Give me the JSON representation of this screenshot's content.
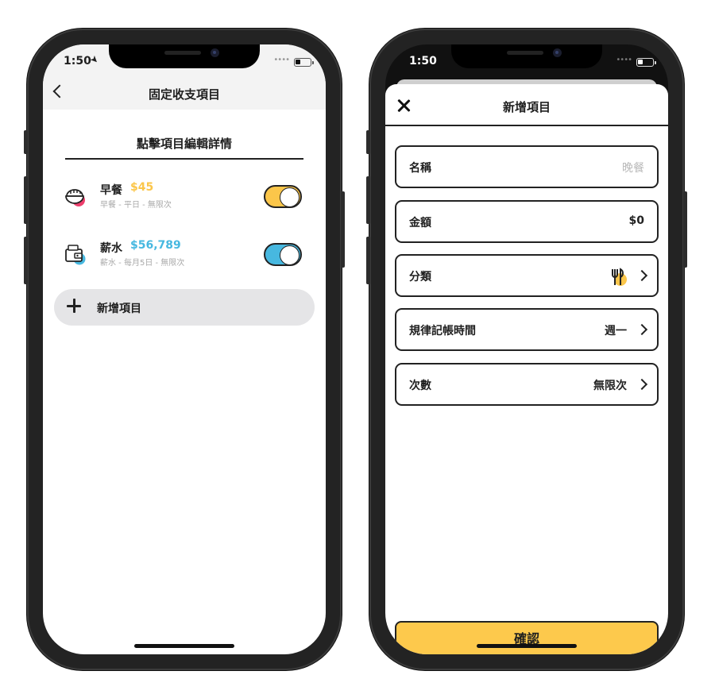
{
  "left_screen": {
    "status": {
      "time": "1:50"
    },
    "header": {
      "title": "固定收支項目"
    },
    "section_title": "點擊項目編輯詳情",
    "items": [
      {
        "name": "早餐",
        "amount": "$45",
        "meta": "早餐 - 平日 - 無限次",
        "icon": "rice-bowl-icon",
        "accent": "#fbc64a",
        "enabled": true
      },
      {
        "name": "薪水",
        "amount": "$56,789",
        "meta": "薪水 - 每月5日 - 無限次",
        "icon": "wallet-icon",
        "accent": "#47b8e0",
        "enabled": true
      }
    ],
    "add_label": "新增項目"
  },
  "right_screen": {
    "status": {
      "time": "1:50"
    },
    "sheet_title": "新增項目",
    "fields": {
      "name": {
        "label": "名稱",
        "placeholder": "晚餐"
      },
      "amount": {
        "label": "金額",
        "value": "$0"
      },
      "category": {
        "label": "分類",
        "icon": "fork-knife-icon"
      },
      "schedule": {
        "label": "規律記帳時間",
        "value": "週一"
      },
      "count": {
        "label": "次數",
        "value": "無限次"
      }
    },
    "confirm_label": "確認"
  },
  "colors": {
    "yellow": "#fbc64a",
    "blue": "#47b8e0",
    "pink": "#ec3e6c",
    "confirm": "#fdc94c"
  }
}
